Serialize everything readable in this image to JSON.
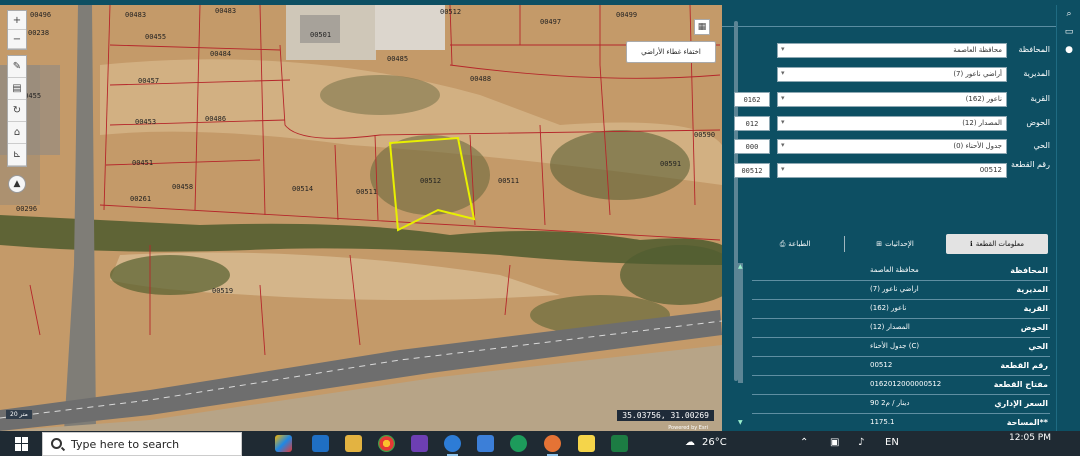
{
  "map": {
    "layer_popup": "اختفاء غطاء الأراضي",
    "coordinates": "35.03756, 31.00269",
    "scale": "20 متر",
    "powered_by": "Powered by Esri",
    "parcel_labels": [
      "00238",
      "00455",
      "00483",
      "00485",
      "00497",
      "00499",
      "00483",
      "00484",
      "00488",
      "00457",
      "00451",
      "00486",
      "00458",
      "00453",
      "00455",
      "00501",
      "00514",
      "00511",
      "00512",
      "00511",
      "00519",
      "00512",
      "00296",
      "00591",
      "00590",
      "00496",
      "00261"
    ],
    "tools": [
      "zoom-in",
      "zoom-out",
      "edit",
      "print",
      "refresh",
      "home",
      "measure"
    ]
  },
  "panel": {
    "fields": [
      {
        "label": "المحافظة",
        "value": "محافظة العاصمة",
        "code": ""
      },
      {
        "label": "المديرية",
        "value": "أراضي ناعور (7)",
        "code": ""
      },
      {
        "label": "القرية",
        "value": "ناعور (162)",
        "code": "0162"
      },
      {
        "label": "الحوض",
        "value": "المصدار (12)",
        "code": "012"
      },
      {
        "label": "الحي",
        "value": "جدول الأحناء (0)",
        "code": "000"
      },
      {
        "label": "رقم القطعة",
        "value": "00512",
        "code": "00512"
      }
    ],
    "tabs": [
      {
        "label": "معلومات القطعة",
        "icon": "info-icon",
        "active": true
      },
      {
        "label": "الإحداثيات",
        "icon": "coordinates-icon",
        "active": false
      },
      {
        "label": "الطباعة",
        "icon": "print-icon",
        "active": false
      }
    ],
    "info_rows": [
      {
        "key": "المحافظة",
        "value": "محافظة العاصمة"
      },
      {
        "key": "المديرية",
        "value": "اراضي ناعور (7)"
      },
      {
        "key": "القرية",
        "value": "ناعور (162)"
      },
      {
        "key": "الحوض",
        "value": "المصدار (12)"
      },
      {
        "key": "الحي",
        "value": "جدول الأحناء (C)"
      },
      {
        "key": "رقم القطعة",
        "value": "00512"
      },
      {
        "key": "مفتاح القطعة",
        "value": "0162012000000512"
      },
      {
        "key": "السعر الإداري",
        "value": "90 دينار / م2"
      },
      {
        "key": "المساحة**",
        "value": "1175.1"
      }
    ]
  },
  "taskbar": {
    "search_placeholder": "Type here to search",
    "weather": "26°C",
    "time": "12:05 PM",
    "date": ""
  },
  "colors": {
    "panel_bg": "#0d4f63",
    "selected_parcel": "#e8f000",
    "parcel_lines": "#b5262a"
  }
}
